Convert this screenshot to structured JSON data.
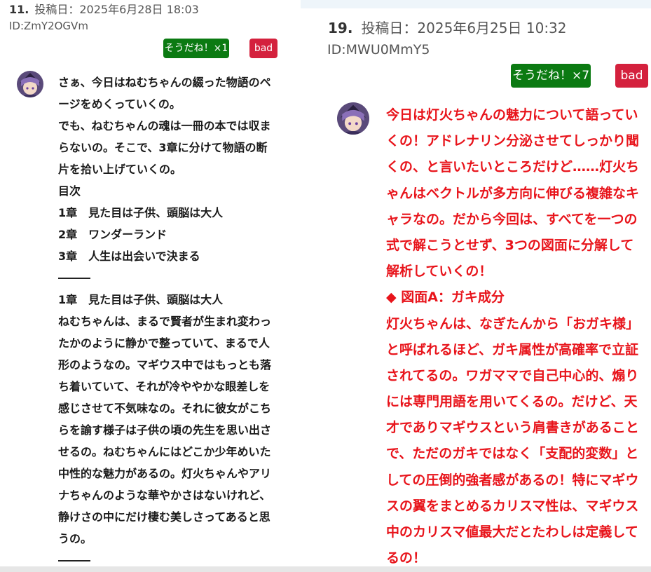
{
  "left_post": {
    "number": "11.",
    "posted": "投稿日：2025年6月28日 18:03",
    "id": "ID:ZmY2OGVm",
    "agree_button": "そうだね！×1",
    "bad_button": "bad",
    "lines": [
      "さぁ、今日はねむちゃんの綴った物語のペ",
      "ージをめくっていくの。",
      "でも、ねむちゃんの魂は一冊の本では収ま",
      "らないの。そこで、3章に分けて物語の断",
      "片を拾い上げていくの。",
      "目次",
      "1章　見た目は子供、頭脳は大人",
      "2章　ワンダーランド",
      "3章　人生は出会いで決まる",
      "",
      "1章　見た目は子供、頭脳は大人",
      "ねむちゃんは、まるで賢者が生まれ変わっ",
      "たかのように静かで整っていて、まるで人",
      "形のようなの。マギウス中ではもっとも落",
      "ち着いていて、それが冷ややかな眼差しを",
      "感じさせて不気味なの。それに彼女がこち",
      "らを諭す様子は子供の頃の先生を思い出さ",
      "せるの。ねむちゃんにはどこか少年めいた",
      "中性的な魅力があるの。灯火ちゃんやアリ",
      "ナちゃんのような華やかさはないけれど、",
      "静けさの中にだけ棲む美しさってあると思",
      "うの。",
      ""
    ]
  },
  "right_post": {
    "number": "19.",
    "posted": "投稿日：2025年6月25日 10:32",
    "id": "ID:MWU0MmY5",
    "agree_button": "そうだね！×7",
    "bad_button": "bad",
    "lines": [
      "今日は灯火ちゃんの魅力について語ってい",
      "くの！アドレナリン分泌させてしっかり聞",
      "くの、と言いたいところだけど……灯火ち",
      "ゃんはベクトルが多方向に伸びる複雑なキ",
      "ャラなの。だから今回は、すべてを一つの",
      "式で解こうとせず、3つの図面に分解して",
      "解析していくの！",
      "◆ 図面A：ガキ成分",
      "灯火ちゃんは、なぎたんから「おガキ様」",
      "と呼ばれるほど、ガキ属性が高確率で立証",
      "されてるの。ワガママで自己中心的、煽り",
      "には専門用語を用いてくるの。だけど、天",
      "才でありマギウスという肩書きがあること",
      "で、ただのガキではなく「支配的変数」と",
      "しての圧倒的強者感があるの！特にマギウ",
      "スの翼をまとめるカリスマ性は、マギウス",
      "中のカリスマ値最大だとたわしは定義して",
      "るの！"
    ]
  },
  "colors": {
    "agree": "#0b7a12",
    "bad": "#d4213d",
    "right_text": "#e8141b"
  }
}
